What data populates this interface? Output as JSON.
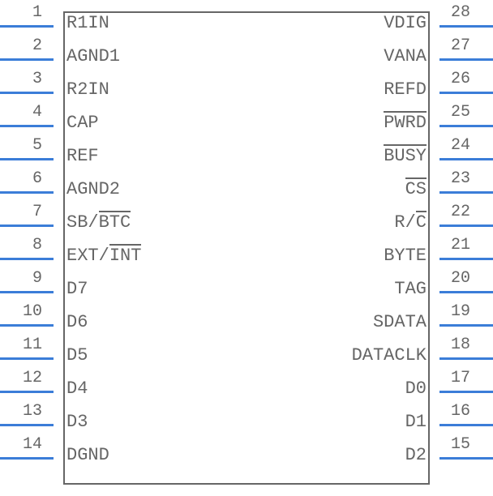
{
  "chart_data": {
    "type": "table",
    "title": "IC pinout (28-pin)",
    "left_pins": [
      {
        "num": "1",
        "label": "R1IN",
        "overline": []
      },
      {
        "num": "2",
        "label": "AGND1",
        "overline": []
      },
      {
        "num": "3",
        "label": "R2IN",
        "overline": []
      },
      {
        "num": "4",
        "label": "CAP",
        "overline": []
      },
      {
        "num": "5",
        "label": "REF",
        "overline": []
      },
      {
        "num": "6",
        "label": "AGND2",
        "overline": []
      },
      {
        "num": "7",
        "label": "SB/BTC",
        "overline": [
          "BTC"
        ]
      },
      {
        "num": "8",
        "label": "EXT/INT",
        "overline": [
          "INT"
        ]
      },
      {
        "num": "9",
        "label": "D7",
        "overline": []
      },
      {
        "num": "10",
        "label": "D6",
        "overline": []
      },
      {
        "num": "11",
        "label": "D5",
        "overline": []
      },
      {
        "num": "12",
        "label": "D4",
        "overline": []
      },
      {
        "num": "13",
        "label": "D3",
        "overline": []
      },
      {
        "num": "14",
        "label": "DGND",
        "overline": []
      }
    ],
    "right_pins": [
      {
        "num": "28",
        "label": "VDIG",
        "overline": []
      },
      {
        "num": "27",
        "label": "VANA",
        "overline": []
      },
      {
        "num": "26",
        "label": "REFD",
        "overline": []
      },
      {
        "num": "25",
        "label": "PWRD",
        "overline": [
          "PWRD"
        ]
      },
      {
        "num": "24",
        "label": "BUSY",
        "overline": [
          "BUSY"
        ]
      },
      {
        "num": "23",
        "label": "CS",
        "overline": [
          "CS"
        ]
      },
      {
        "num": "22",
        "label": "R/C",
        "overline": [
          "C"
        ]
      },
      {
        "num": "21",
        "label": "BYTE",
        "overline": []
      },
      {
        "num": "20",
        "label": "TAG",
        "overline": []
      },
      {
        "num": "19",
        "label": "SDATA",
        "overline": []
      },
      {
        "num": "18",
        "label": "DATACLK",
        "overline": []
      },
      {
        "num": "17",
        "label": "D0",
        "overline": []
      },
      {
        "num": "16",
        "label": "D1",
        "overline": []
      },
      {
        "num": "15",
        "label": "D2",
        "overline": []
      }
    ]
  }
}
